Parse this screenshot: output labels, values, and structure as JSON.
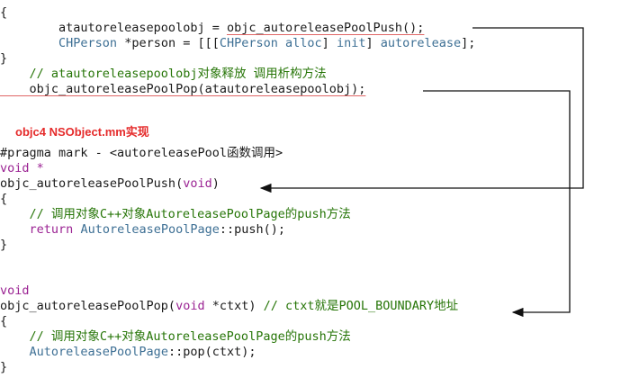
{
  "top_code": [
    "{",
    "        atautoreleasepoolobj = objc_autoreleasePoolPush();",
    "        CHPerson *person = [[[CHPerson alloc] init] autorelease];",
    "}",
    "    // atautoreleasepoolobj对象释放 调用析构方法",
    "    objc_autoreleasePoolPop(atautoreleasepoolobj);"
  ],
  "section_title": "objc4 NSObject.mm实现",
  "bottom_code": [
    "#pragma mark - <autoreleasePool函数调用>",
    "void *",
    "objc_autoreleasePoolPush(void)",
    "{",
    "    // 调用对象C++对象AutoreleasePoolPage的push方法",
    "    return AutoreleasePoolPage::push();",
    "}",
    "",
    "",
    "void",
    "objc_autoreleasePoolPop(void *ctxt) // ctxt就是POOL_BOUNDARY地址",
    "{",
    "    // 调用对象C++对象AutoreleasePoolPage的push方法",
    "    AutoreleasePoolPage::pop(ctxt);",
    "}"
  ],
  "colors": {
    "keyword": "#9b2393",
    "class": "#3d6f94",
    "comment": "#267507",
    "title": "#e52b2b",
    "underline": "#e06666"
  }
}
